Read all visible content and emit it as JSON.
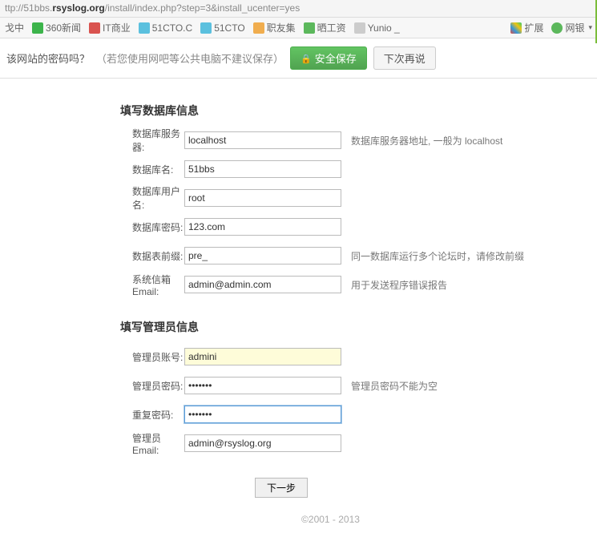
{
  "url": {
    "prefix": "ttp://51bbs.",
    "domain": "rsyslog.org",
    "path": "/install/index.php?step=3&install_ucenter=yes"
  },
  "bookmarks": {
    "items": [
      {
        "label": "戈中",
        "color": "#888"
      },
      {
        "label": "360新闻",
        "color": "#3cb44b"
      },
      {
        "label": "IT商业",
        "color": "#d9534f"
      },
      {
        "label": "51CTO.C",
        "color": "#5bc0de"
      },
      {
        "label": "51CTO",
        "color": "#5bc0de"
      },
      {
        "label": "职友集",
        "color": "#f0ad4e"
      },
      {
        "label": "晒工资",
        "color": "#5cb85c"
      },
      {
        "label": "Yunio _",
        "color": "#999"
      }
    ],
    "extend": "扩展",
    "wangyin": "网银"
  },
  "infobar": {
    "question": "该网站的密码吗？",
    "hint": "（若您使用网吧等公共电脑不建议保存）",
    "save": "安全保存",
    "later": "下次再说"
  },
  "form": {
    "db_section": "填写数据库信息",
    "db_server_label": "数据库服务器:",
    "db_server_value": "localhost",
    "db_server_desc": "数据库服务器地址, 一般为 localhost",
    "db_name_label": "数据库名:",
    "db_name_value": "51bbs",
    "db_user_label": "数据库用户名:",
    "db_user_value": "root",
    "db_pass_label": "数据库密码:",
    "db_pass_value": "123.com",
    "db_prefix_label": "数据表前缀:",
    "db_prefix_value": "pre_",
    "db_prefix_desc": "同一数据库运行多个论坛时，请修改前缀",
    "sys_email_label": "系统信箱 Email:",
    "sys_email_value": "admin@admin.com",
    "sys_email_desc": "用于发送程序错误报告",
    "admin_section": "填写管理员信息",
    "admin_user_label": "管理员账号:",
    "admin_user_value": "admini",
    "admin_pass_label": "管理员密码:",
    "admin_pass_value": "•••••••",
    "admin_pass_desc": "管理员密码不能为空",
    "admin_pass2_label": "重复密码:",
    "admin_pass2_value": "•••••••",
    "admin_email_label": "管理员 Email:",
    "admin_email_value": "admin@rsyslog.org",
    "next_button": "下一步"
  },
  "footer": "©2001 - 2013"
}
